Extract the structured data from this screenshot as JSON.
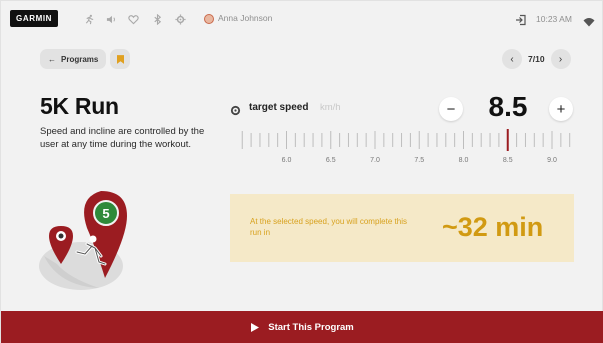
{
  "topbar": {
    "logo_text": "GARMIN",
    "icons": [
      "run-icon",
      "volume-icon",
      "heart-icon",
      "bluetooth-icon",
      "settings-icon"
    ],
    "user_name": "Anna Johnson",
    "time": "10:23 AM"
  },
  "nav": {
    "back_label": "Programs",
    "pager": "7/10"
  },
  "program": {
    "title": "5K Run",
    "description": "Speed and incline are controlled by the user at any time during the workout."
  },
  "speed": {
    "label": "target speed",
    "unit": "km/h",
    "value": "8.5",
    "minus": "−",
    "plus": "+",
    "ruler": {
      "tick_labels": [
        "6.0",
        "6.5",
        "7.0",
        "7.5",
        "8.0",
        "8.5",
        "9.0"
      ],
      "selected": 8.5
    }
  },
  "estimate": {
    "text": "At the selected speed, you will complete this run in",
    "time": "~32 min"
  },
  "cta": {
    "label": "Start This Program"
  },
  "colors": {
    "accent": "#9b1c21",
    "highlight": "#d19a12",
    "info_bg": "#f5e9c8",
    "badge_green": "#2f8a3a"
  }
}
